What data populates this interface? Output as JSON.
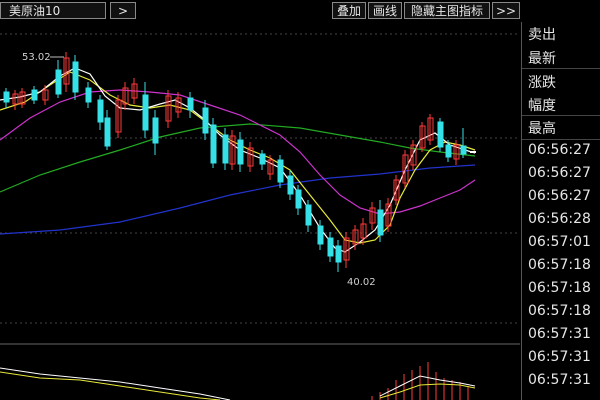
{
  "toolbar": {
    "symbol": "美原油10",
    "more_left": ">",
    "overlay": "叠加",
    "draw": "画线",
    "hide_main": "隐藏主图指标",
    "more_right": ">>"
  },
  "chart": {
    "high_label": "53.02",
    "low_label": "40.02"
  },
  "side_panel": {
    "labels": [
      "卖出",
      "最新",
      "涨跌",
      "幅度",
      "最高"
    ],
    "times": [
      "06:56:27",
      "06:56:27",
      "06:56:27",
      "06:56:28",
      "06:57:01",
      "06:57:18",
      "06:57:18",
      "06:57:18",
      "06:57:31",
      "06:57:31",
      "06:57:31"
    ]
  },
  "colors": {
    "up": "#ff3b3b",
    "down": "#35e0e6",
    "ma_white": "#ffffff",
    "ma_yellow": "#e8e83a",
    "ma_magenta": "#cc33cc",
    "ma_green": "#22aa22",
    "ma_blue": "#2233cc"
  }
}
